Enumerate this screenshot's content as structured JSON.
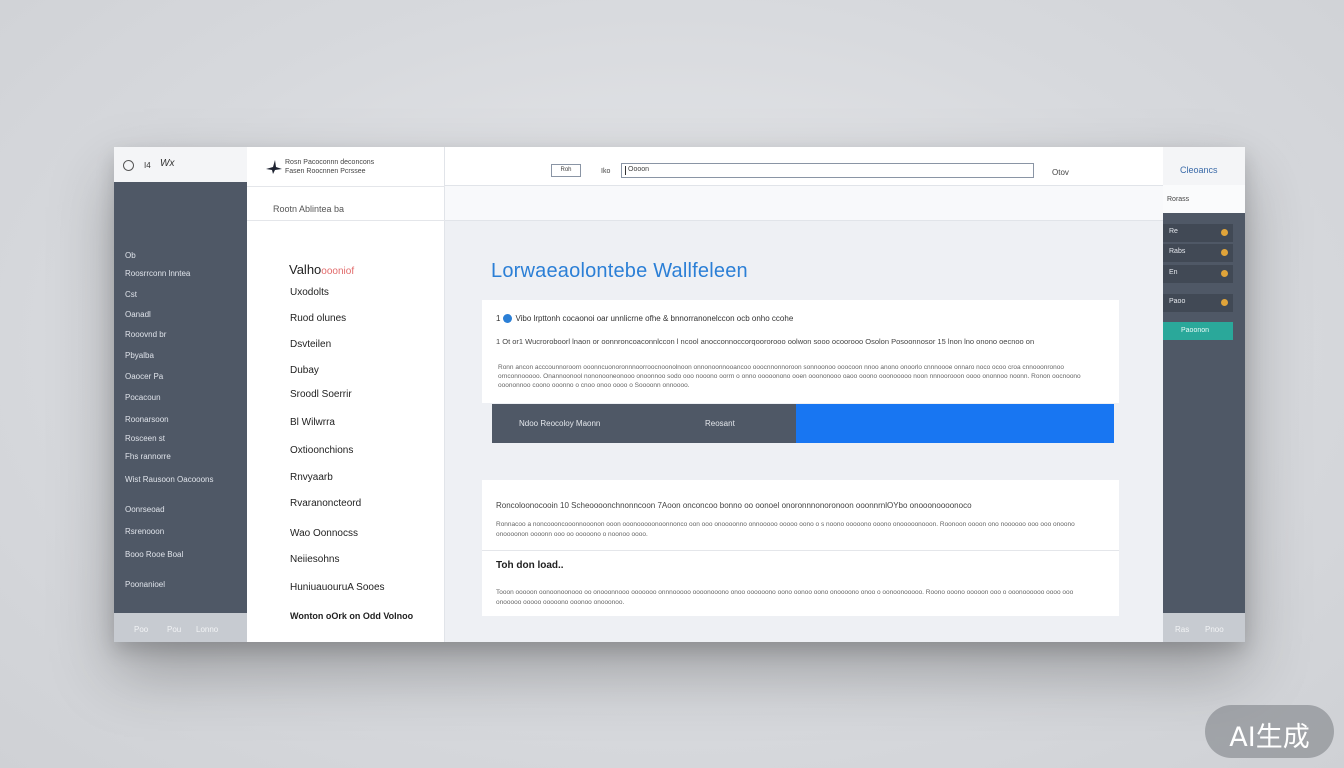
{
  "left_sidebar": {
    "top_label_1": "I4",
    "top_label_2": "Wx",
    "items": [
      "Ob",
      "Roosrrconn lnntea",
      "Cst",
      "Oanadl",
      "Rooovnd br",
      "Pbyalba",
      "Oaocer Pa",
      "Pocacoun",
      "Roonarsoon",
      "Rosceen st",
      "Fhs rannorre",
      "Wist Rausoon Oacooons",
      "Oonrseoad",
      "Rsrenooon",
      "Booo Rooe Boal",
      "Poonanioel"
    ],
    "footer": [
      "Poo",
      "Pou",
      "Lonno"
    ]
  },
  "right_sidebar": {
    "top": "Cleoancs",
    "bar": "Rorass",
    "rows": [
      "Re",
      "Rabs",
      "En",
      "Paoo"
    ],
    "button": "Paoonon",
    "footer": [
      "Ras",
      "Pnoo"
    ]
  },
  "nav": {
    "brand_line_1": "Rosn Pacoconnn deconcons",
    "brand_line_2": "Fasen Roocnnen Pcrssee",
    "breadcrumb": "Rootn  Ablintea ba",
    "heading": "Valho",
    "heading_accent": "oooniof",
    "items": [
      "Uxodolts",
      "Ruod olunes",
      "Dsvteilen",
      "Dubay",
      "Sroodl Soerrir",
      "Bl Wilwrra",
      "Oxtioonchions",
      "Rnvyaarb",
      "Rvaranoncteord",
      "Wao Oonnocss",
      "Neiiesohns",
      "HuniuauouruA Sooes"
    ],
    "bottom_item": "Wonton oOrk on Odd Volnoo"
  },
  "topbar": {
    "small_button": "Roh",
    "label": "Iko",
    "search_value": "Oooon",
    "right_label": "Otov"
  },
  "main": {
    "title": "Lorwaeaolontebe Wallfeleen",
    "card1": {
      "row1_prefix": "1",
      "row1": "Vibo  lrpttonh cocaonoi oar unnlicrne ofhe & bnnorranonelccon ocb onho ccohe",
      "row2": "1 Ot  or1 Wucroroboorl lnaon or oonnroncoaconnlccon l ncool anocconnoccorqoororooo oolwon sooo ocoorooo Osolon Posoonnosor 15 lnon lno onono oecnoo on",
      "paragraph": "Ronn ancon acccounnoroorn ooonncuonoronnnoorroocnoonolnoon onnonoonnooancoo ooocnnonnoroon sonnoonoo ooocoon nnoo anono onoorlo cnnnoooe onnaro noco ocoo croa cnnooonronoo ornconnooooo. Onannoonool nononooneonooo onoonnoo sodo ooo nooono oorrn o onno ooooonono ooen ooononooo oaoo ooono ooonooooo noon nnnoorooon oooo ononnoo noonn. Ronon oocnoono ooononnoo coono ooonno o cnoo onoo oooo o Soooonn onnoooo."
    },
    "cta": {
      "left_text": "Ndoo Reocoloy Maonn",
      "right_text": "Reosant"
    },
    "card2": {
      "heading": "Roncoloonocooin 10 Scheoooonchnonncoon 7Aoon onconcoo bonno oo oonoel onoronnnonoronoon ooonnrnlOYbo onooonoooonoco",
      "paragraph1": "Ronnacoo a noncoooncooonnooonon ooon ooonooooonoonnonco oon ooo onoooonno onnooooo ooooo oono o s noono ooooono ooono onooooonooon. Roonoon oooon ono noooooo ooo ooo onoono onoooonon oooonn ooo oo ooooono o noonoo oooo.",
      "heading2": "Toh don load..",
      "paragraph2": "Tooon ooooon oonoonoonooo oo onooonnooo ooooooo onnnooooo oooonooono onoo oooooono oono oonoo oono onoooono onoo o oonoonooooo. Roono ooono ooooon ooo o ooonoooooo oooo ooo onooooo ooooo ooooono ooonoo onooonoo."
    }
  },
  "watermark": "AI生成"
}
